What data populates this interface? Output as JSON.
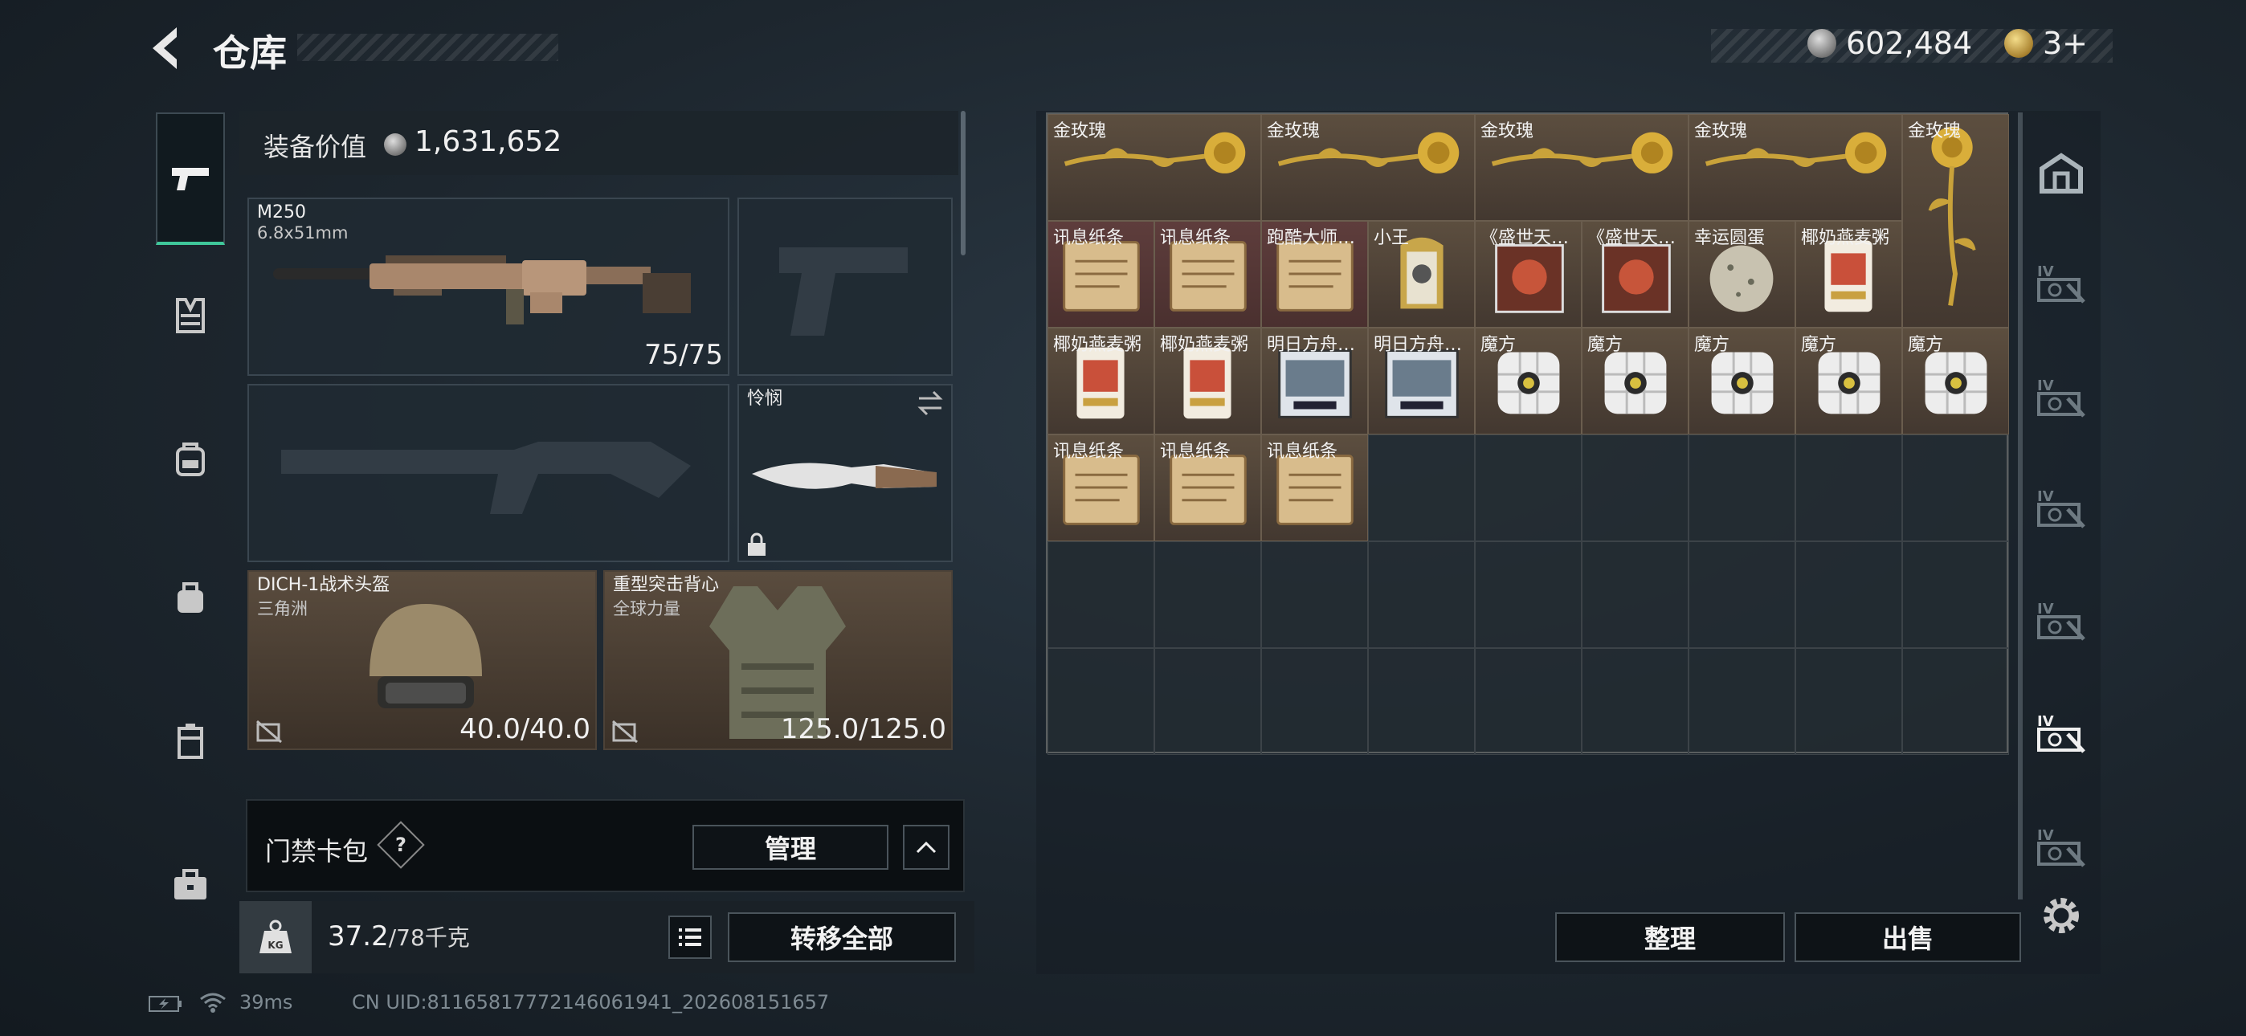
{
  "header": {
    "title": "仓库",
    "currency_silver": "602,484",
    "currency_gold": "3+"
  },
  "nav_left": {
    "items": [
      "pistol-icon",
      "vest-icon",
      "backpack-icon",
      "chest-rig-icon",
      "case-icon",
      "briefcase-icon"
    ],
    "active": 0
  },
  "equipment": {
    "value_label": "装备价值",
    "value": "1,631,652",
    "primary": {
      "name": "M250",
      "caliber": "6.8x51mm",
      "ammo": "75/75"
    },
    "melee": {
      "name": "怜悯"
    },
    "helmet": {
      "name": "DICH-1战术头盔",
      "brand": "三角洲",
      "durability": "40.0/40.0"
    },
    "armor": {
      "name": "重型突击背心",
      "brand": "全球力量",
      "durability": "125.0/125.0"
    }
  },
  "access_card": {
    "label": "门禁卡包",
    "help": "?",
    "manage": "管理"
  },
  "weight": {
    "current": "37.2",
    "max": "/78千克",
    "kg_label": "KG",
    "transfer_all": "转移全部"
  },
  "status_bar": {
    "ping": "39ms",
    "uid": "CN UID:81165817772146061941_202608151657"
  },
  "stash": {
    "items": [
      {
        "name": "金玫瑰",
        "art": "rose-h",
        "color": "brown",
        "col": 0,
        "row": 0,
        "w": 2,
        "h": 1
      },
      {
        "name": "金玫瑰",
        "art": "rose-h",
        "color": "brown",
        "col": 2,
        "row": 0,
        "w": 2,
        "h": 1
      },
      {
        "name": "金玫瑰",
        "art": "rose-h",
        "color": "brown",
        "col": 4,
        "row": 0,
        "w": 2,
        "h": 1
      },
      {
        "name": "金玫瑰",
        "art": "rose-h",
        "color": "brown",
        "col": 6,
        "row": 0,
        "w": 2,
        "h": 1
      },
      {
        "name": "金玫瑰",
        "art": "rose-v",
        "color": "brown",
        "col": 8,
        "row": 0,
        "w": 1,
        "h": 2
      },
      {
        "name": "讯息纸条",
        "art": "note",
        "color": "red",
        "col": 0,
        "row": 1,
        "w": 1,
        "h": 1
      },
      {
        "name": "讯息纸条",
        "art": "note",
        "color": "red",
        "col": 1,
        "row": 1,
        "w": 1,
        "h": 1
      },
      {
        "name": "跑酷大师…",
        "art": "note",
        "color": "red",
        "col": 2,
        "row": 1,
        "w": 1,
        "h": 1
      },
      {
        "name": "小王",
        "art": "badge",
        "color": "brown",
        "col": 3,
        "row": 1,
        "w": 1,
        "h": 1
      },
      {
        "name": "《盛世天…",
        "art": "album",
        "color": "brown",
        "col": 4,
        "row": 1,
        "w": 1,
        "h": 1
      },
      {
        "name": "《盛世天…",
        "art": "album",
        "color": "brown",
        "col": 5,
        "row": 1,
        "w": 1,
        "h": 1
      },
      {
        "name": "幸运圆蛋",
        "art": "egg",
        "color": "brown",
        "col": 6,
        "row": 1,
        "w": 1,
        "h": 1
      },
      {
        "name": "椰奶燕麦粥",
        "art": "can",
        "color": "brown",
        "col": 7,
        "row": 1,
        "w": 1,
        "h": 1
      },
      {
        "name": "椰奶燕麦粥",
        "art": "can",
        "color": "brown",
        "col": 0,
        "row": 2,
        "w": 1,
        "h": 1
      },
      {
        "name": "椰奶燕麦粥",
        "art": "can",
        "color": "brown",
        "col": 1,
        "row": 2,
        "w": 1,
        "h": 1
      },
      {
        "name": "明日方舟…",
        "art": "cd",
        "color": "brown",
        "col": 2,
        "row": 2,
        "w": 1,
        "h": 1
      },
      {
        "name": "明日方舟…",
        "art": "cd",
        "color": "brown",
        "col": 3,
        "row": 2,
        "w": 1,
        "h": 1
      },
      {
        "name": "魔方",
        "art": "cube",
        "color": "brown",
        "col": 4,
        "row": 2,
        "w": 1,
        "h": 1
      },
      {
        "name": "魔方",
        "art": "cube",
        "color": "brown",
        "col": 5,
        "row": 2,
        "w": 1,
        "h": 1
      },
      {
        "name": "魔方",
        "art": "cube",
        "color": "brown",
        "col": 6,
        "row": 2,
        "w": 1,
        "h": 1
      },
      {
        "name": "魔方",
        "art": "cube",
        "color": "brown",
        "col": 7,
        "row": 2,
        "w": 1,
        "h": 1
      },
      {
        "name": "魔方",
        "art": "cube",
        "color": "brown",
        "col": 8,
        "row": 2,
        "w": 1,
        "h": 1
      },
      {
        "name": "讯息纸条",
        "art": "note",
        "color": "brown",
        "col": 0,
        "row": 3,
        "w": 1,
        "h": 1
      },
      {
        "name": "讯息纸条",
        "art": "note",
        "color": "brown",
        "col": 1,
        "row": 3,
        "w": 1,
        "h": 1
      },
      {
        "name": "讯息纸条",
        "art": "note",
        "color": "brown",
        "col": 2,
        "row": 3,
        "w": 1,
        "h": 1
      }
    ],
    "organize": "整理",
    "sell": "出售"
  },
  "nav_right": {
    "tabs": [
      "home-stash-icon",
      "case-iv-icon",
      "case-iv-icon",
      "case-iv-icon",
      "case-iv-icon",
      "case-iv-icon",
      "case-iv-icon"
    ],
    "tab_label": "IV",
    "active": 5
  }
}
